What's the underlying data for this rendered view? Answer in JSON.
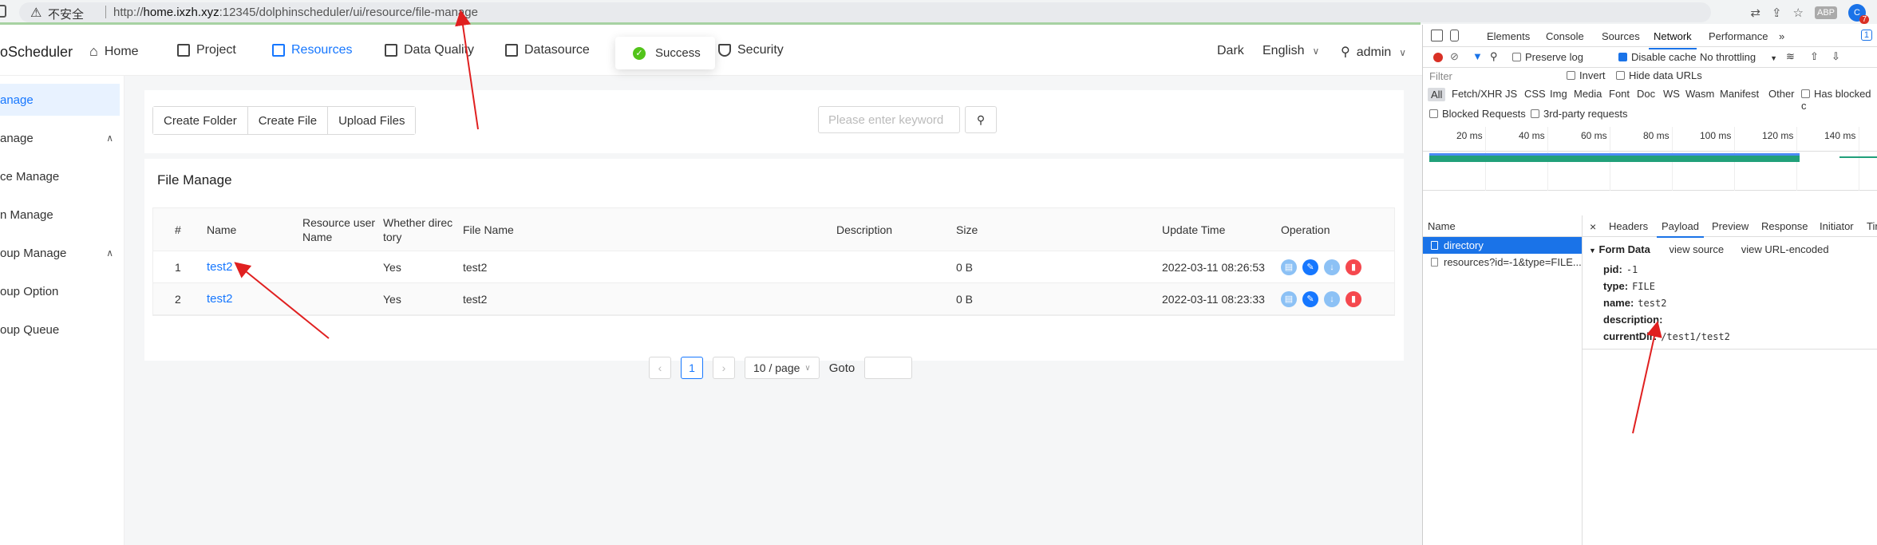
{
  "browser": {
    "insecure_label": "不安全",
    "url_prefix": "http://",
    "url_host": "home.ixzh.xyz",
    "url_rest": ":12345/dolphinscheduler/ui/resource/file-manage",
    "abp_label": "ABP",
    "ext_badge": "7"
  },
  "nav": {
    "logo": "oScheduler",
    "items": [
      {
        "label": "Home"
      },
      {
        "label": "Project"
      },
      {
        "label": "Resources"
      },
      {
        "label": "Data Quality"
      },
      {
        "label": "Datasource"
      },
      {
        "label": "Security"
      }
    ],
    "theme": "Dark",
    "language": "English",
    "user": "admin"
  },
  "toast": {
    "message": "Success"
  },
  "sidebar": {
    "items": [
      {
        "label": "anage"
      },
      {
        "label": "anage"
      },
      {
        "label": "ce Manage"
      },
      {
        "label": "n Manage"
      },
      {
        "label": "oup Manage"
      },
      {
        "label": "oup Option"
      },
      {
        "label": "oup Queue"
      }
    ]
  },
  "toolbar": {
    "create_folder": "Create Folder",
    "create_file": "Create File",
    "upload_files": "Upload Files",
    "search_placeholder": "Please enter keyword"
  },
  "file_manage": {
    "title": "File Manage",
    "columns": {
      "index": "#",
      "name": "Name",
      "resource_user_name_1": "Resource user",
      "resource_user_name_2": "Name",
      "whether_directory_1": "Whether direc",
      "whether_directory_2": "tory",
      "file_name": "File Name",
      "description": "Description",
      "size": "Size",
      "update_time": "Update Time",
      "operation": "Operation"
    },
    "rows": [
      {
        "index": "1",
        "name": "test2",
        "user": "",
        "directory": "Yes",
        "file_name": "test2",
        "description": "",
        "size": "0 B",
        "update_time": "2022-03-11 08:26:53"
      },
      {
        "index": "2",
        "name": "test2",
        "user": "",
        "directory": "Yes",
        "file_name": "test2",
        "description": "",
        "size": "0 B",
        "update_time": "2022-03-11 08:23:33"
      }
    ],
    "pagination": {
      "current_page": "1",
      "page_size": "10 / page",
      "goto_label": "Goto"
    }
  },
  "devtools": {
    "tabs": [
      "Elements",
      "Console",
      "Sources",
      "Network",
      "Performance"
    ],
    "more": "»",
    "badge": "1",
    "preserve_log": "Preserve log",
    "disable_cache": "Disable cache",
    "throttling": "No throttling",
    "filter_placeholder": "Filter",
    "invert": "Invert",
    "hide_data_urls": "Hide data URLs",
    "types": [
      "All",
      "Fetch/XHR",
      "JS",
      "CSS",
      "Img",
      "Media",
      "Font",
      "Doc",
      "WS",
      "Wasm",
      "Manifest",
      "Other"
    ],
    "has_blocked": "Has blocked c",
    "blocked_requests": "Blocked Requests",
    "third_party": "3rd-party requests",
    "timeline_labels": [
      "20 ms",
      "40 ms",
      "60 ms",
      "80 ms",
      "100 ms",
      "120 ms",
      "140 ms"
    ],
    "name_header": "Name",
    "requests": [
      {
        "name": "directory"
      },
      {
        "name": "resources?id=-1&type=FILE..."
      }
    ],
    "detail_tabs": [
      "Headers",
      "Payload",
      "Preview",
      "Response",
      "Initiator",
      "Tir"
    ],
    "close": "×",
    "form_data": {
      "title": "Form Data",
      "view_source": "view source",
      "view_url_encoded": "view URL-encoded",
      "fields": [
        {
          "key": "pid:",
          "value": "-1"
        },
        {
          "key": "type:",
          "value": "FILE"
        },
        {
          "key": "name:",
          "value": "test2"
        },
        {
          "key": "description:",
          "value": ""
        },
        {
          "key": "currentDir:",
          "value": "/test1/test2"
        }
      ]
    }
  },
  "colors": {
    "primary": "#1677ff",
    "success": "#52c41a",
    "danger": "#f5484e",
    "annotation": "#e02020"
  }
}
